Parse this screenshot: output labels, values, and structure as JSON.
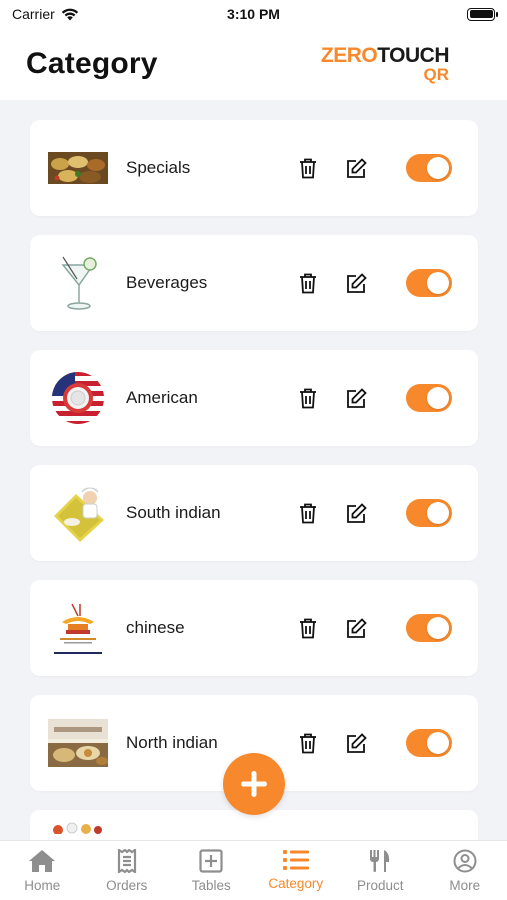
{
  "status": {
    "carrier": "Carrier",
    "time": "3:10 PM"
  },
  "header": {
    "title": "Category",
    "brand": {
      "zero": "ZERO",
      "touch": "TOUCH",
      "qr": "QR"
    }
  },
  "categories": [
    {
      "name": "Specials",
      "image": "food-platter-image",
      "enabled": true
    },
    {
      "name": "Beverages",
      "image": "cocktail-glass-image",
      "enabled": true
    },
    {
      "name": "American",
      "image": "american-flag-plate-image",
      "enabled": true
    },
    {
      "name": "South indian",
      "image": "chef-banana-leaf-image",
      "enabled": true
    },
    {
      "name": "chinese",
      "image": "chinese-pagoda-logo-image",
      "enabled": true
    },
    {
      "name": "North indian",
      "image": "north-indian-cuisine-image",
      "enabled": true
    }
  ],
  "tabs": [
    {
      "label": "Home",
      "icon": "home-icon"
    },
    {
      "label": "Orders",
      "icon": "receipt-icon"
    },
    {
      "label": "Tables",
      "icon": "plus-square-icon"
    },
    {
      "label": "Category",
      "icon": "list-icon",
      "active": true
    },
    {
      "label": "Product",
      "icon": "fork-knife-icon"
    },
    {
      "label": "More",
      "icon": "user-circle-icon"
    }
  ],
  "colors": {
    "accent": "#f7892c",
    "background": "#f2f3f7",
    "inactive_tab": "#8e8e8e"
  }
}
